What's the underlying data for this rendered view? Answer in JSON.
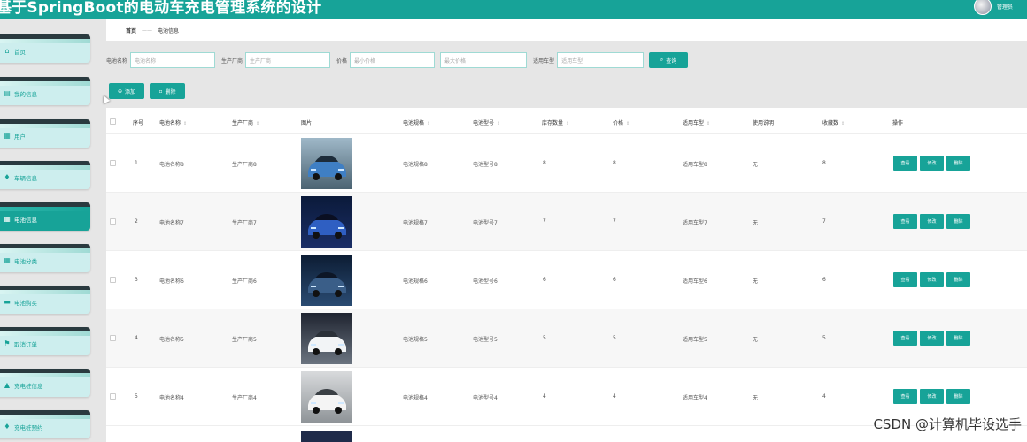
{
  "header": {
    "title": "基于SpringBoot的电动车充电管理系统的设计",
    "user_name": "管理员"
  },
  "sidebar": {
    "items": [
      {
        "label": "首页",
        "icon": "home-icon",
        "glyph": "⌂",
        "active": false
      },
      {
        "label": "我的信息",
        "icon": "profile-icon",
        "glyph": "▤",
        "active": false
      },
      {
        "label": "用户",
        "icon": "grid-icon",
        "glyph": "▦",
        "active": false
      },
      {
        "label": "车辆信息",
        "icon": "location-icon",
        "glyph": "♦",
        "active": false
      },
      {
        "label": "电池信息",
        "icon": "grid-icon",
        "glyph": "▦",
        "active": true
      },
      {
        "label": "电池分类",
        "icon": "grid-icon",
        "glyph": "▦",
        "active": false
      },
      {
        "label": "电池购买",
        "icon": "folder-icon",
        "glyph": "▬",
        "active": false
      },
      {
        "label": "取消订单",
        "icon": "flag-icon",
        "glyph": "⚑",
        "active": false
      },
      {
        "label": "充电桩信息",
        "icon": "user-icon",
        "glyph": "▲",
        "active": false
      },
      {
        "label": "充电桩预约",
        "icon": "location-icon",
        "glyph": "♦",
        "active": false
      }
    ]
  },
  "breadcrumb": {
    "home": "首页",
    "separator": "——",
    "current": "电池信息"
  },
  "search": {
    "name_label": "电池名称",
    "name_placeholder": "电池名称",
    "maker_label": "生产厂商",
    "maker_placeholder": "生产厂商",
    "price_label": "价格",
    "price_min_placeholder": "最小价格",
    "price_max_placeholder": "最大价格",
    "model_label": "适用车型",
    "model_placeholder": "适用车型",
    "search_button": "查询"
  },
  "actions": {
    "add_button": "添加",
    "delete_button": "删除"
  },
  "table": {
    "columns": [
      "序号",
      "电池名称",
      "生产厂商",
      "图片",
      "电池规格",
      "电池型号",
      "库存数量",
      "价格",
      "适用车型",
      "使用说明",
      "收藏数",
      "操作"
    ],
    "row_actions": {
      "view": "查看",
      "edit": "修改",
      "delete": "删除"
    },
    "rows": [
      {
        "index": "1",
        "name": "电池名称8",
        "maker": "生产厂商8",
        "spec": "电池规格8",
        "model": "电池型号8",
        "stock": "8",
        "price": "8",
        "car": "适用车型8",
        "desc": "无",
        "fav": "8",
        "img": "car-blue-suv"
      },
      {
        "index": "2",
        "name": "电池名称7",
        "maker": "生产厂商7",
        "spec": "电池规格7",
        "model": "电池型号7",
        "stock": "7",
        "price": "7",
        "car": "适用车型7",
        "desc": "无",
        "fav": "7",
        "img": "car-blue-night"
      },
      {
        "index": "3",
        "name": "电池名称6",
        "maker": "生产厂商6",
        "spec": "电池规格6",
        "model": "电池型号6",
        "stock": "6",
        "price": "6",
        "car": "适用车型6",
        "desc": "无",
        "fav": "6",
        "img": "car-charging-night"
      },
      {
        "index": "4",
        "name": "电池名称5",
        "maker": "生产厂商5",
        "spec": "电池规格5",
        "model": "电池型号5",
        "stock": "5",
        "price": "5",
        "car": "适用车型5",
        "desc": "无",
        "fav": "5",
        "img": "car-white-studio"
      },
      {
        "index": "5",
        "name": "电池名称4",
        "maker": "生产厂商4",
        "spec": "电池规格4",
        "model": "电池型号4",
        "stock": "4",
        "price": "4",
        "car": "适用车型4",
        "desc": "无",
        "fav": "4",
        "img": "car-white-street"
      }
    ]
  },
  "watermark": "CSDN @计算机毕设选手",
  "colors": {
    "accent": "#17a398",
    "menu_bg": "#cdeeee",
    "menu_bar": "#2a3a3f"
  }
}
